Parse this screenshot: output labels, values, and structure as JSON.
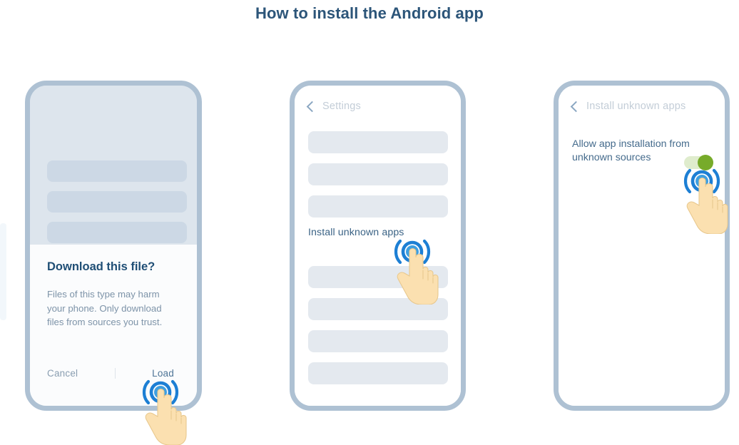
{
  "page": {
    "title": "How to install the Android app",
    "title_color": "#2c5579",
    "background": "#ffffff"
  },
  "steps": [
    {
      "id": "step-1-download",
      "phone_screen": "browser-download-dialog",
      "skeleton_rows": 3,
      "dialog": {
        "title": "Download this file?",
        "body": "Files of this type may harm your phone. Only download files from sources you trust.",
        "cancel_label": "Cancel",
        "confirm_label": "Load"
      },
      "tap_target": "Load"
    },
    {
      "id": "step-2-settings",
      "phone_screen": "settings-list",
      "nav": {
        "back_icon": "chevron-left-icon",
        "title": "Settings"
      },
      "skeleton_rows_above": 3,
      "list_item_label": "Install unknown apps",
      "skeleton_rows_below": 4,
      "tap_target": "Install unknown apps"
    },
    {
      "id": "step-3-allow",
      "phone_screen": "install-unknown-apps",
      "nav": {
        "back_icon": "chevron-left-icon",
        "title": "Install unknown apps"
      },
      "setting": {
        "label": "Allow app installation from unknown sources",
        "toggle_state": "on",
        "toggle_track_color": "#dfeccd",
        "toggle_knob_color": "#77ab2a"
      },
      "tap_target": "Allow app installation toggle"
    }
  ],
  "theme": {
    "phone_frame_color": "#aec1d3",
    "skeleton_bar_color_light": "#e4e9ef",
    "skeleton_bar_color_dark": "#ccd8e5",
    "phone1_screen_bg": "#dde5ed",
    "dialog_bg": "#fbfcfd",
    "dialog_title_color": "#1f4e75",
    "dialog_body_color": "#7d93a8",
    "nav_title_color": "#c3cdd7",
    "link_color": "#3c6486",
    "tap_icon_color": "#1d7fd4",
    "hand_color": "#fbe0b0"
  }
}
